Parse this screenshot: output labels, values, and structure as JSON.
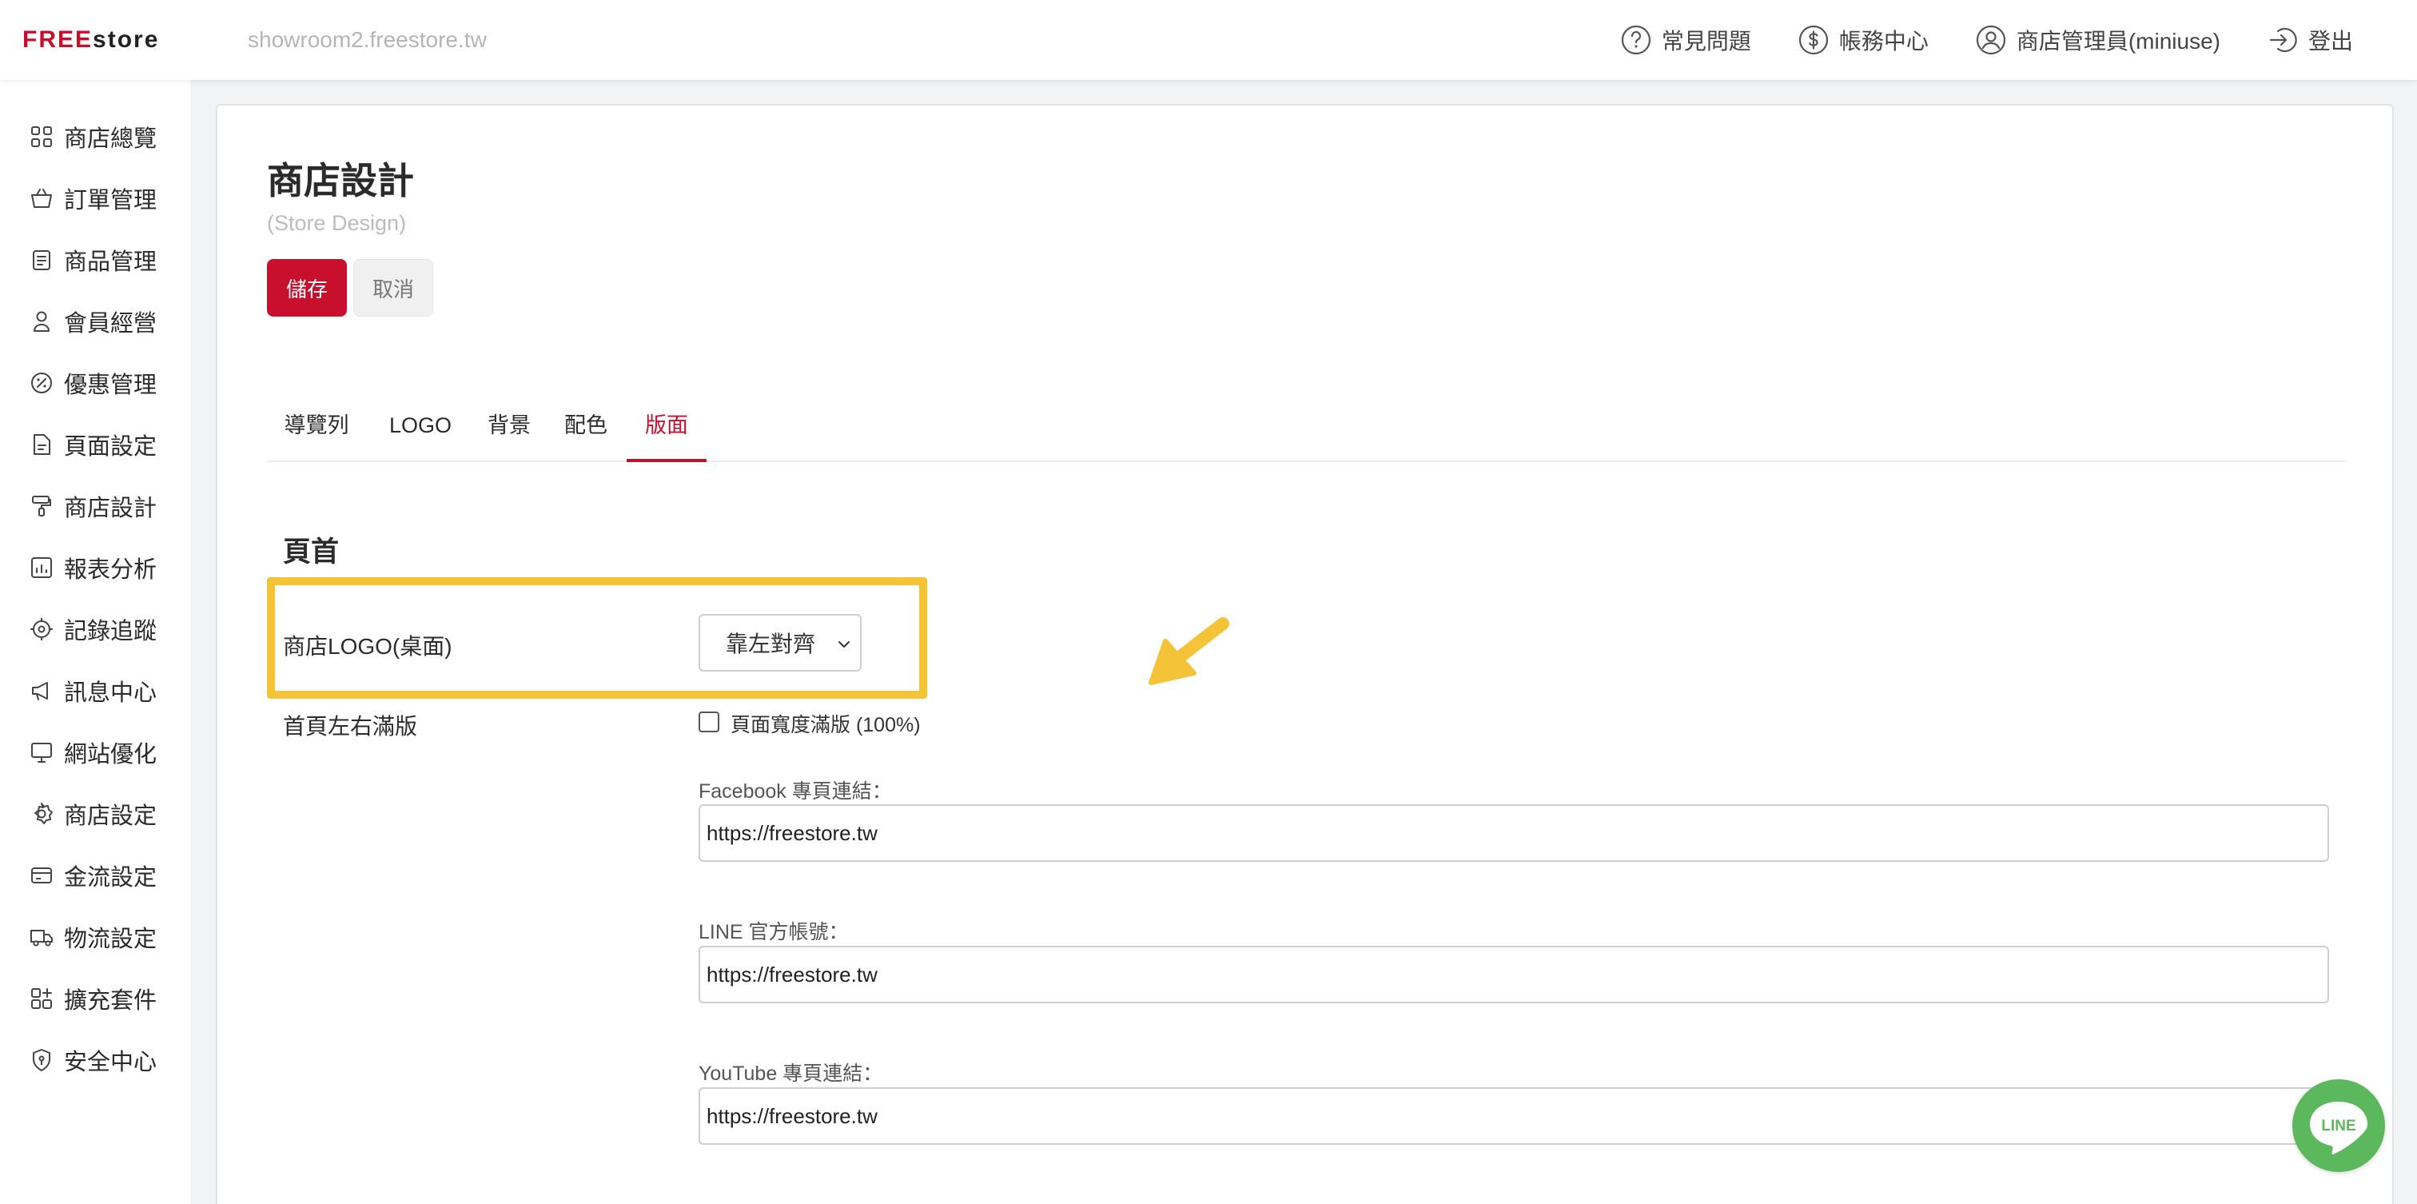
{
  "brand": {
    "logo_free": "FREE",
    "logo_store": "store",
    "domain": "showroom2.freestore.tw"
  },
  "topnav": {
    "faq": "常見問題",
    "billing": "帳務中心",
    "admin": "商店管理員(miniuse)",
    "logout": "登出"
  },
  "sidebar": {
    "items": [
      {
        "label": "商店總覽",
        "icon": "grid-icon"
      },
      {
        "label": "訂單管理",
        "icon": "basket-icon"
      },
      {
        "label": "商品管理",
        "icon": "clipboard-icon"
      },
      {
        "label": "會員經營",
        "icon": "user-icon"
      },
      {
        "label": "優惠管理",
        "icon": "badge-icon"
      },
      {
        "label": "頁面設定",
        "icon": "file-icon"
      },
      {
        "label": "商店設計",
        "icon": "paint-roller-icon"
      },
      {
        "label": "報表分析",
        "icon": "chart-icon"
      },
      {
        "label": "記錄追蹤",
        "icon": "target-icon"
      },
      {
        "label": "訊息中心",
        "icon": "megaphone-icon"
      },
      {
        "label": "網站優化",
        "icon": "monitor-icon"
      },
      {
        "label": "商店設定",
        "icon": "gear-icon"
      },
      {
        "label": "金流設定",
        "icon": "card-icon"
      },
      {
        "label": "物流設定",
        "icon": "truck-icon"
      },
      {
        "label": "擴充套件",
        "icon": "puzzle-icon"
      },
      {
        "label": "安全中心",
        "icon": "shield-icon"
      }
    ]
  },
  "page": {
    "title": "商店設計",
    "subtitle": "(Store Design)",
    "save": "儲存",
    "cancel": "取消"
  },
  "tabs": [
    {
      "label": "導覽列",
      "active": false
    },
    {
      "label": "LOGO",
      "active": false
    },
    {
      "label": "背景",
      "active": false
    },
    {
      "label": "配色",
      "active": false
    },
    {
      "label": "版面",
      "active": true
    }
  ],
  "section": {
    "title": "頁首",
    "logo_label": "商店LOGO(桌面)",
    "logo_select_value": "靠左對齊",
    "fullwidth_label": "首頁左右滿版",
    "fullwidth_checkbox_label": "頁面寬度滿版 (100%)",
    "fullwidth_checked": false
  },
  "fields": [
    {
      "label": "Facebook 專頁連結：",
      "value": "https://freestore.tw"
    },
    {
      "label": "LINE 官方帳號：",
      "value": "https://freestore.tw"
    },
    {
      "label": "YouTube 專頁連結：",
      "value": "https://freestore.tw"
    }
  ],
  "line_chat": {
    "label": "LINE"
  },
  "colors": {
    "accent": "#c8102e",
    "highlight": "#f5c338",
    "line_green": "#5cb85c"
  }
}
